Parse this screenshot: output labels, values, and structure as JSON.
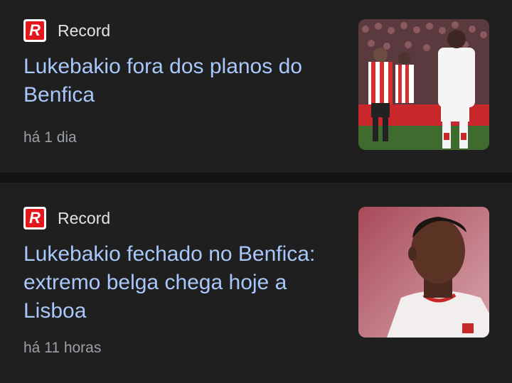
{
  "articles": [
    {
      "source": "Record",
      "logo_letter": "R",
      "headline": "Lukebakio fora dos planos do Benfica",
      "time": "há 1 dia",
      "thumbnail": "football-players-photo"
    },
    {
      "source": "Record",
      "logo_letter": "R",
      "headline": "Lukebakio fechado no Benfica: extremo belga chega hoje a Lisboa",
      "time": "há 11 horas",
      "thumbnail": "player-portrait-photo"
    }
  ],
  "colors": {
    "background": "#131314",
    "card": "#1f1f1f",
    "headline": "#a8c7fa",
    "source_text": "#e3e3e3",
    "time_text": "#9aa0a6",
    "logo_red": "#e3161b"
  }
}
